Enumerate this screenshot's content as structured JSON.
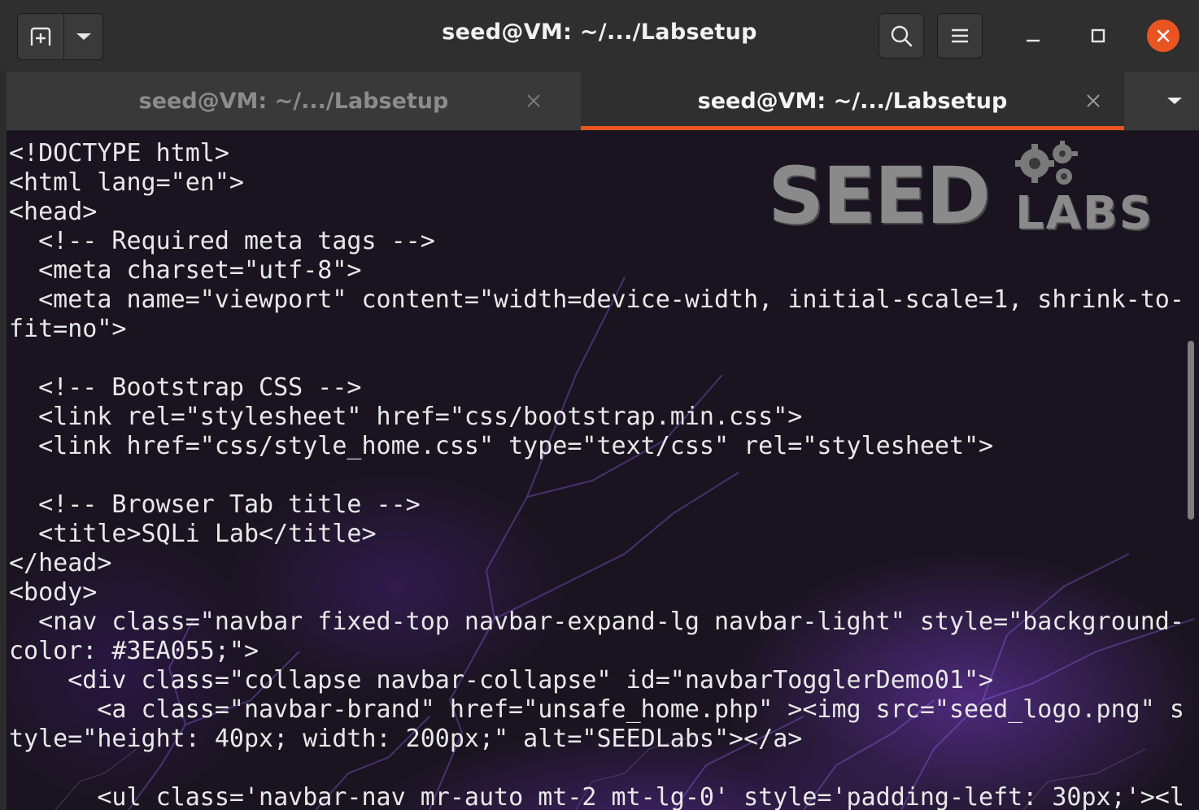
{
  "window": {
    "title": "seed@VM: ~/.../Labsetup"
  },
  "header": {
    "new_tab_icon": "new-tab-icon",
    "menu_dropdown_icon": "chevron-down-icon",
    "search_icon": "search-icon",
    "hamburger_icon": "hamburger-menu-icon",
    "minimize_icon": "minimize-icon",
    "maximize_icon": "maximize-icon",
    "close_icon": "close-icon"
  },
  "tabs": [
    {
      "label": "seed@VM: ~/.../Labsetup",
      "active": false
    },
    {
      "label": "seed@VM: ~/.../Labsetup",
      "active": true
    }
  ],
  "accent_color": "#e95420",
  "logo": {
    "main": "SEED",
    "sub": "LABS"
  },
  "terminal": {
    "lines": [
      "<!DOCTYPE html>",
      "<html lang=\"en\">",
      "<head>",
      "  <!-- Required meta tags -->",
      "  <meta charset=\"utf-8\">",
      "  <meta name=\"viewport\" content=\"width=device-width, initial-scale=1, shrink-to-",
      "fit=no\">",
      "",
      "  <!-- Bootstrap CSS -->",
      "  <link rel=\"stylesheet\" href=\"css/bootstrap.min.css\">",
      "  <link href=\"css/style_home.css\" type=\"text/css\" rel=\"stylesheet\">",
      "",
      "  <!-- Browser Tab title -->",
      "  <title>SQLi Lab</title>",
      "</head>",
      "<body>",
      "  <nav class=\"navbar fixed-top navbar-expand-lg navbar-light\" style=\"background-",
      "color: #3EA055;\">",
      "    <div class=\"collapse navbar-collapse\" id=\"navbarTogglerDemo01\">",
      "      <a class=\"navbar-brand\" href=\"unsafe_home.php\" ><img src=\"seed_logo.png\" s",
      "tyle=\"height: 40px; width: 200px;\" alt=\"SEEDLabs\"></a>",
      "",
      "      <ul class='navbar-nav mr-auto mt-2 mt-lg-0' style='padding-left: 30px;'><l"
    ]
  }
}
